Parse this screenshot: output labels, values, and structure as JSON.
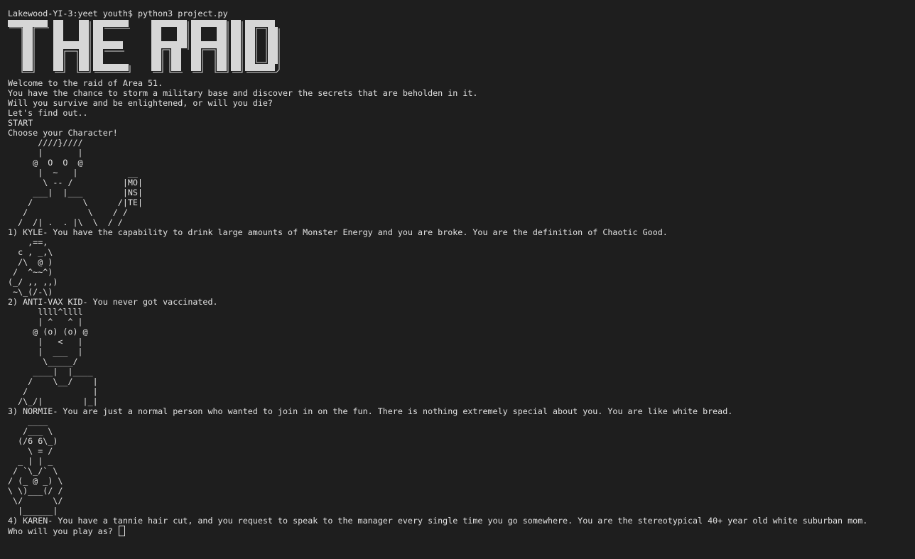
{
  "terminal": {
    "prompt_line": "Lakewood-YI-3:yeet youth$ python3 project.py",
    "banner_text": "THE RAID",
    "intro": [
      "Welcome to the raid of Area 51.",
      "You have the chance to storm a military base and discover the secrets that are beholden in it.",
      "Will you survive and be enlightened, or will you die?",
      "Let's find out..",
      "START",
      "Choose your Character!"
    ],
    "kyle_art": [
      "      ////}////",
      "      |       |",
      "     @  O  O  @",
      "      |  ~   |          __",
      "       \\ -- /          |MO|",
      "     ___|  |___        |NS|",
      "    /          \\      /|TE|",
      "   /            \\    / /",
      "  /  /| .  . |\\  \\  / /"
    ],
    "kyle_desc": "1) KYLE- You have the capability to drink large amounts of Monster Energy and you are broke. You are the definition of Chaotic Good.",
    "antivax_art": [
      "    ,==,",
      "  c , _,\\",
      "  /\\  @ )",
      " /  ^~~^)",
      "(_/ ,, ,,)",
      " ~\\_(/-\\)"
    ],
    "antivax_desc": "2) ANTI-VAX KID- You never got vaccinated.",
    "normie_art": [
      "      llll^llll",
      "      | ^   ^ |",
      "     @ (o) (o) @",
      "      |   <   |",
      "      |  ___  |",
      "       \\_____/",
      "     ____|  |____",
      "    /    \\__/    |",
      "   /             |",
      "  /\\_/|        |_|"
    ],
    "normie_desc": "3) NORMIE- You are just a normal person who wanted to join in on the fun. There is nothing extremely special about you. You are like white bread.",
    "karen_art": [
      "    ____",
      "   /___ \\",
      "  (/6 6\\_)",
      "    \\ = /",
      "  _ | | _",
      " / `\\_/` \\",
      "/ (_ @ _) \\",
      "\\ \\)___(/ /",
      " \\/      \\/",
      "  |______|"
    ],
    "karen_desc": "4) KAREN- You have a tannie hair cut, and you request to speak to the manager every single time you go somewhere. You are the stereotypical 40+ year old white suburban mom.",
    "question": "Who will you play as?"
  }
}
